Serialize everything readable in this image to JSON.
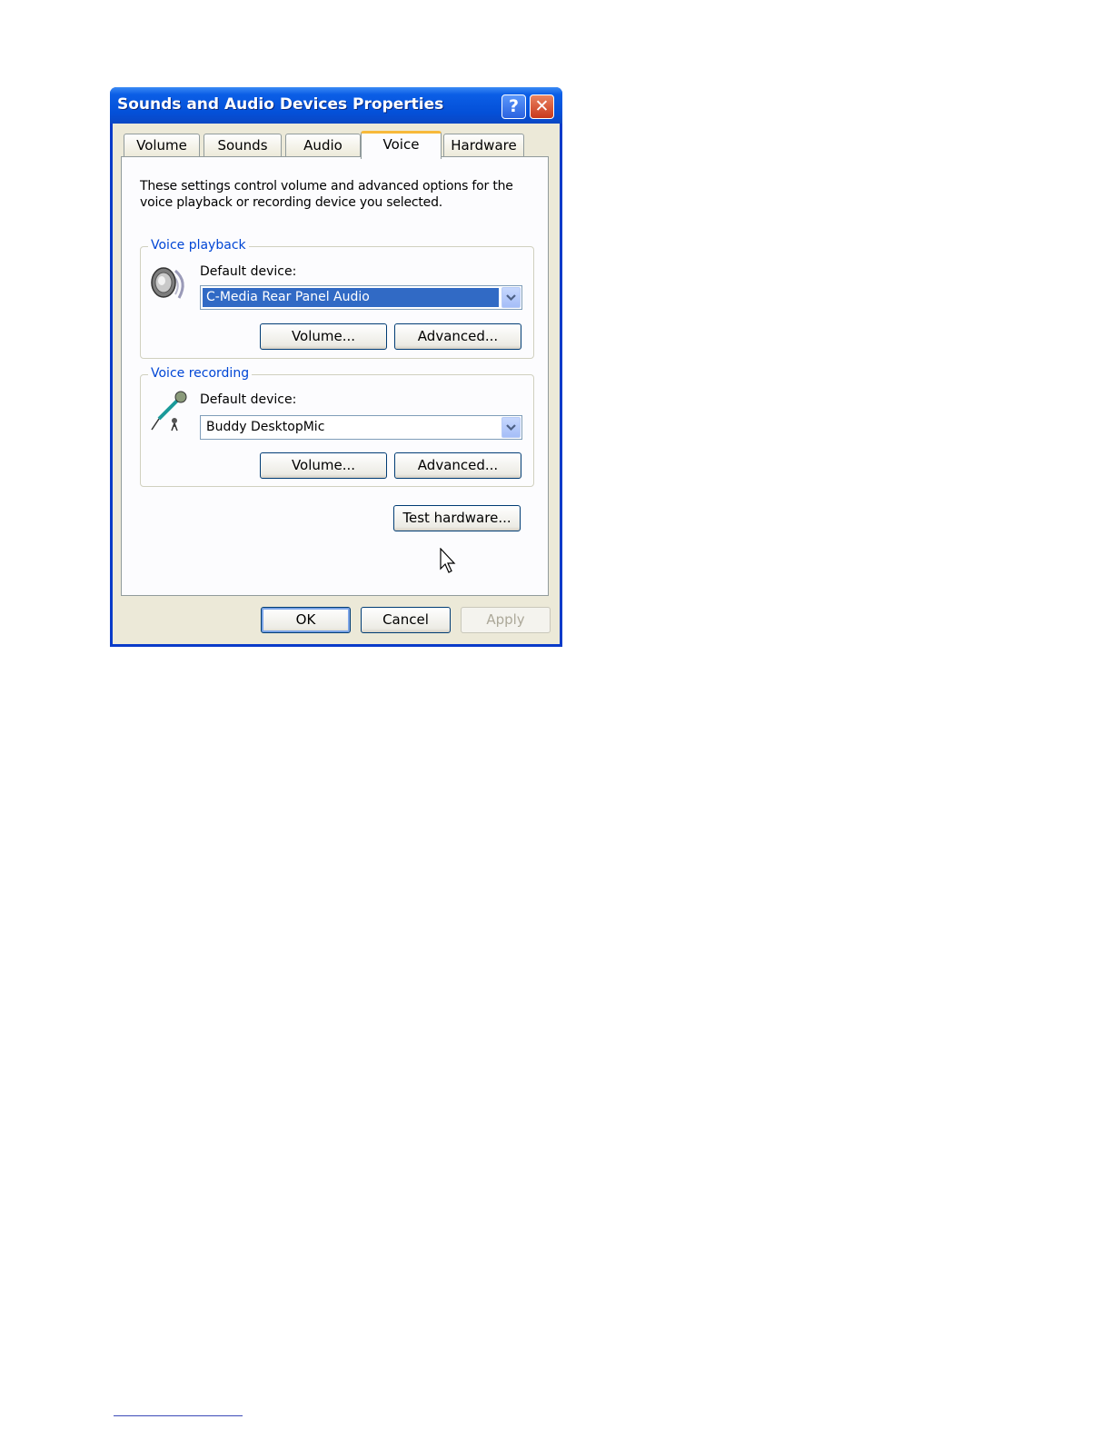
{
  "window": {
    "title": "Sounds and Audio Devices Properties",
    "help_glyph": "?",
    "close_glyph": "✕"
  },
  "tabs": [
    {
      "label": "Volume",
      "active": false
    },
    {
      "label": "Sounds",
      "active": false
    },
    {
      "label": "Audio",
      "active": false
    },
    {
      "label": "Voice",
      "active": true
    },
    {
      "label": "Hardware",
      "active": false
    }
  ],
  "voice_tab": {
    "description": "These settings control volume and advanced options for the voice playback or recording device you selected.",
    "playback": {
      "legend": "Voice playback",
      "icon": "speaker-icon",
      "device_label": "Default device:",
      "device_value": "C-Media Rear Panel Audio",
      "volume_button": "Volume...",
      "advanced_button": "Advanced..."
    },
    "recording": {
      "legend": "Voice recording",
      "icon": "microphone-icon",
      "device_label": "Default device:",
      "device_value": "Buddy DesktopMic",
      "volume_button": "Volume...",
      "advanced_button": "Advanced..."
    },
    "test_hardware_button": "Test hardware..."
  },
  "footer": {
    "ok": "OK",
    "cancel": "Cancel",
    "apply": "Apply",
    "apply_enabled": false
  },
  "colors": {
    "titlebar": "#0450d8",
    "dialog_face": "#ece9d8",
    "group_legend": "#0046d5",
    "selection": "#316ac5",
    "active_tab_highlight": "#f7b93a"
  }
}
